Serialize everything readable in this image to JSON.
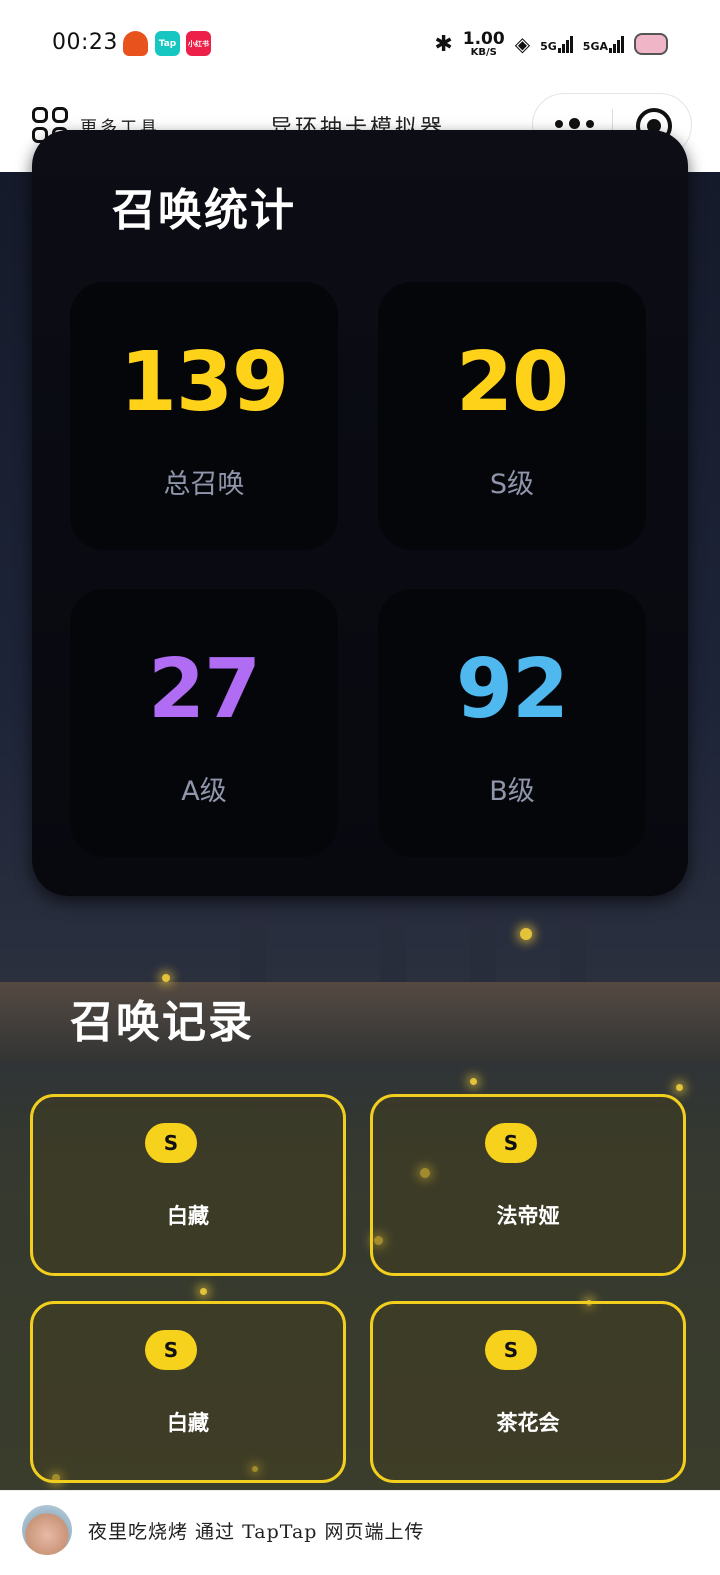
{
  "status_bar": {
    "time": "00:23",
    "app_badges": [
      "",
      "Tap",
      "小红书"
    ],
    "net_speed": "1.00",
    "net_unit": "KB/S",
    "signal_1": "5G",
    "signal_2": "5GA",
    "icons": [
      "bluetooth-icon",
      "wifi-icon",
      "signal-icon",
      "battery-icon"
    ]
  },
  "nav": {
    "more_tools_label": "更多工具",
    "title": "异环抽卡模拟器",
    "icons": [
      "grid-icon",
      "more-dots-icon",
      "target-icon"
    ]
  },
  "stats": {
    "title": "召唤统计",
    "items": [
      {
        "value": "139",
        "label": "总召唤",
        "color": "#ffd21a"
      },
      {
        "value": "20",
        "label": "S级",
        "color": "#ffd21a"
      },
      {
        "value": "27",
        "label": "A级",
        "color": "#b06cf2"
      },
      {
        "value": "92",
        "label": "B级",
        "color": "#4fb8ef"
      }
    ]
  },
  "records": {
    "title": "召唤记录",
    "items": [
      {
        "rank": "S",
        "name": "白藏"
      },
      {
        "rank": "S",
        "name": "法帝娅"
      },
      {
        "rank": "S",
        "name": "白藏"
      },
      {
        "rank": "S",
        "name": "茶花会"
      }
    ]
  },
  "footer": {
    "uploader_text": "夜里吃烧烤 通过 TapTap 网页端上传"
  },
  "colors": {
    "accent_gold": "#f2cf1f",
    "card_bg": "#08090f"
  }
}
